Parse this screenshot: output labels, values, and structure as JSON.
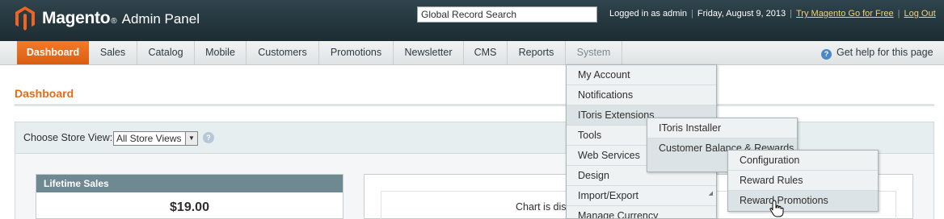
{
  "header": {
    "brand": "Magento",
    "brand_mark": "®",
    "subtitle": "Admin Panel",
    "search_value": "Global Record Search",
    "logged_in": "Logged in as admin",
    "date": "Friday, August 9, 2013",
    "try_link": "Try Magento Go for Free",
    "logout": "Log Out"
  },
  "nav": {
    "items": [
      "Dashboard",
      "Sales",
      "Catalog",
      "Mobile",
      "Customers",
      "Promotions",
      "Newsletter",
      "CMS",
      "Reports",
      "System"
    ],
    "help": "Get help for this page"
  },
  "page": {
    "title": "Dashboard",
    "store_label": "Choose Store View:",
    "store_value": "All Store Views",
    "lifetime_title": "Lifetime Sales",
    "lifetime_value": "$19.00",
    "chart_message": "Chart is dis"
  },
  "system_menu": {
    "items": [
      "My Account",
      "Notifications",
      "IToris Extensions",
      "Tools",
      "Web Services",
      "Design",
      "Import/Export",
      "Manage Currency"
    ]
  },
  "itoris_menu": {
    "items": [
      "IToris Installer",
      "Customer Balance & Rewards"
    ]
  },
  "rewards_menu": {
    "items": [
      "Configuration",
      "Reward Rules",
      "Reward Promotions"
    ]
  },
  "colors": {
    "accent": "#e46c16",
    "header_bg": "#24363d",
    "link": "#f5d07a"
  }
}
